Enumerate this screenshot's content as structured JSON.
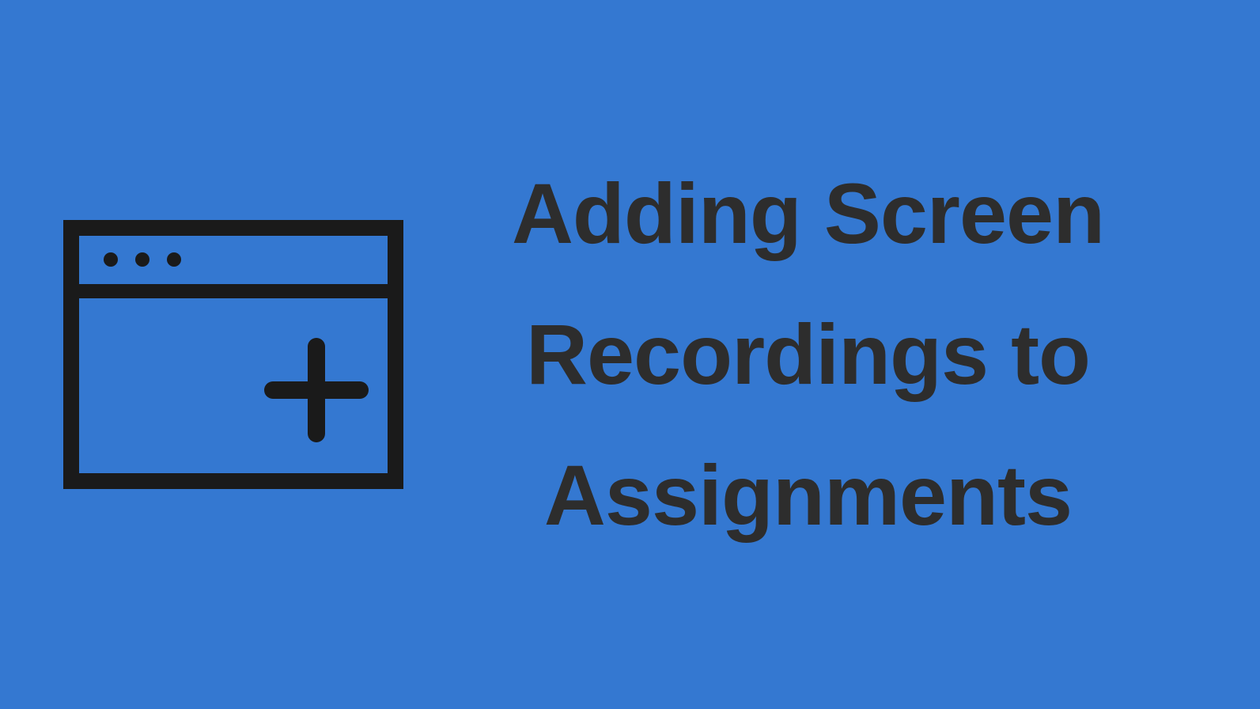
{
  "title": "Adding Screen Recordings to Assignments",
  "colors": {
    "background": "#3478d1",
    "text": "#2d2d2d",
    "icon_stroke": "#1a1a1a"
  }
}
